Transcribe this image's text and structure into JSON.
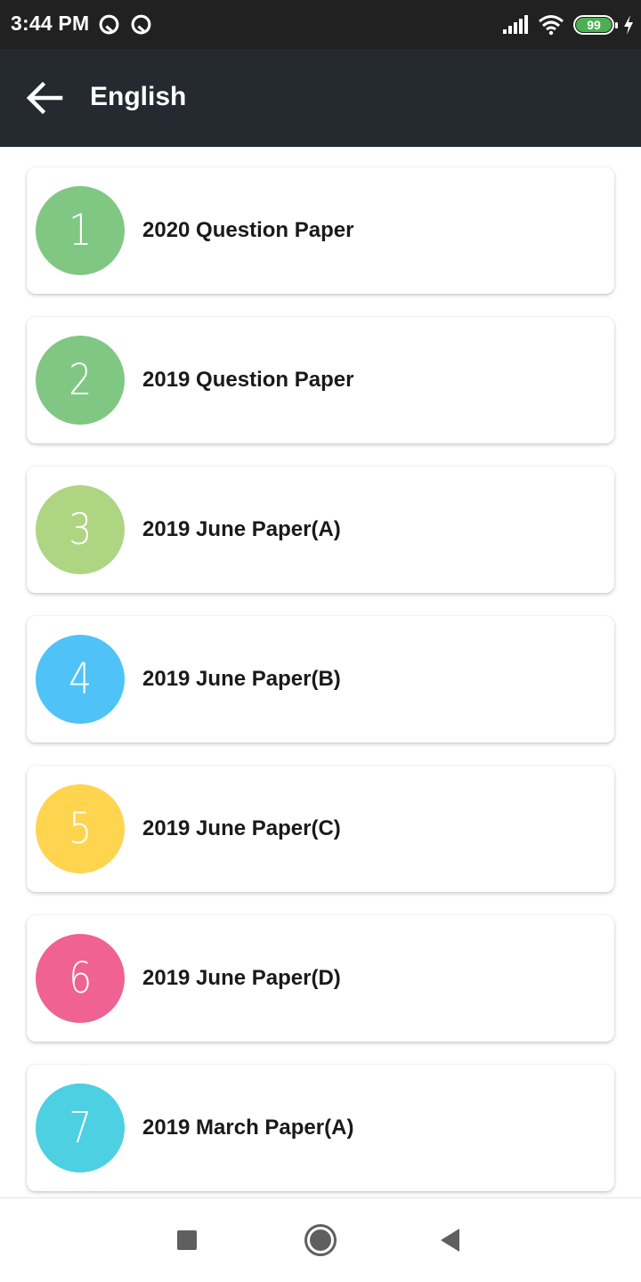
{
  "status_bar": {
    "time": "3:44 PM",
    "notification_icons": [
      "vpn-q-icon",
      "vpn-q-icon"
    ],
    "battery_level": "99",
    "battery_color": "#4caf50",
    "charging": true
  },
  "app_bar": {
    "title": "English",
    "background": "#242a30"
  },
  "papers": [
    {
      "number": "1",
      "title": "2020 Question Paper",
      "color": "#81c784"
    },
    {
      "number": "2",
      "title": "2019 Question Paper",
      "color": "#81c784"
    },
    {
      "number": "3",
      "title": "2019 June Paper(A)",
      "color": "#aed581"
    },
    {
      "number": "4",
      "title": "2019 June Paper(B)",
      "color": "#4fc3f7"
    },
    {
      "number": "5",
      "title": "2019 June Paper(C)",
      "color": "#ffd54f"
    },
    {
      "number": "6",
      "title": "2019 June Paper(D)",
      "color": "#f06292"
    },
    {
      "number": "7",
      "title": "2019 March Paper(A)",
      "color": "#4dd0e1"
    }
  ],
  "nav_bar": {
    "buttons": [
      "recents",
      "home",
      "back"
    ]
  }
}
